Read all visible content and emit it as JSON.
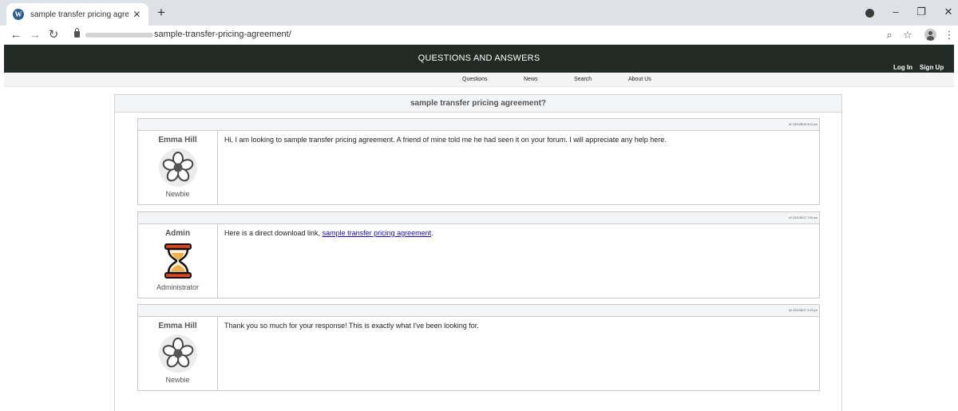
{
  "browser": {
    "tab_title": "sample transfer pricing agreeme",
    "tab_favicon": "W",
    "new_tab_label": "+",
    "url": "sample-transfer-pricing-agreement/",
    "icons": [
      "back-arrow-icon",
      "forward-arrow-icon",
      "reload-icon",
      "lock-icon",
      "zoom-icon",
      "bookmark-star-icon",
      "profile-icon",
      "menu-dots-icon"
    ],
    "window_controls": [
      "minimize",
      "restore",
      "close"
    ]
  },
  "site": {
    "title": "QUESTIONS AND ANSWERS",
    "login": "Log In",
    "signup": "Sign Up",
    "header_color": "#222a25",
    "nav": [
      "Questions",
      "News",
      "Search",
      "About Us"
    ]
  },
  "thread": {
    "title": "sample transfer pricing agreement?",
    "posts": [
      {
        "meta": "#1 2021/08/16 5:02 pm",
        "author": "Emma Hill",
        "rank": "Newbie",
        "avatar": "flower-icon",
        "message": "Hi, I am looking to sample transfer pricing agreement. A friend of mine told me he had seen it on your forum. I will appreciate any help here."
      },
      {
        "meta": "#2 2021/08/17 7:09 am",
        "author": "Admin",
        "rank": "Administrator",
        "avatar": "hourglass-icon",
        "message_prefix": "Here is a direct download link, ",
        "message_link": "sample transfer pricing agreement",
        "message_suffix": "."
      },
      {
        "meta": "#3 2021/08/17 2:15 pm",
        "author": "Emma Hill",
        "rank": "Newbie",
        "avatar": "flower-icon",
        "message": "Thank you so much for your response! This is exactly what I've been looking for."
      }
    ]
  },
  "colors": {
    "link": "#1a0dab",
    "hourglass_frame": "#e0431f",
    "hourglass_sand": "#f0b04a"
  }
}
